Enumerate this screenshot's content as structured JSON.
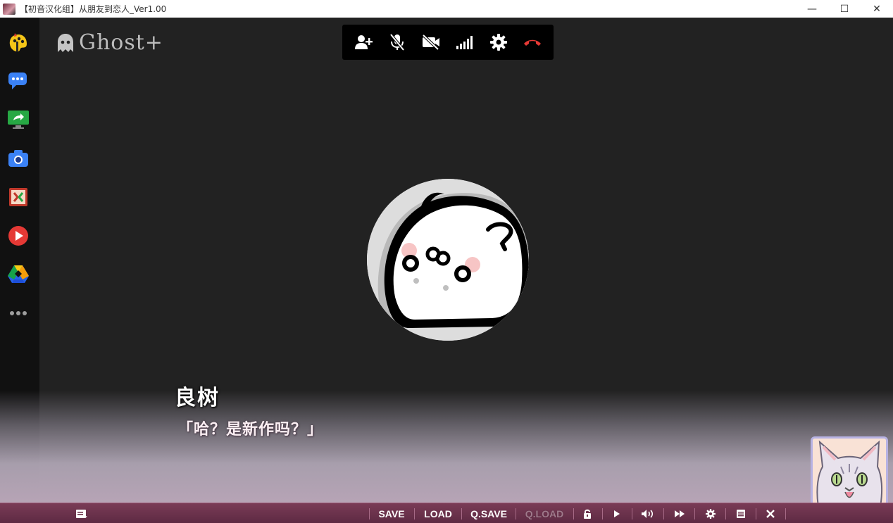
{
  "window": {
    "title": "【初音汉化组】从朋友到恋人_Ver1.00",
    "minimize_glyph": "—",
    "maximize_glyph": "☐",
    "close_glyph": "✕"
  },
  "app": {
    "logo_text": "Ghost+"
  },
  "dock": {
    "items": [
      "paint-palette-icon",
      "chat-bubbles-icon",
      "screen-share-icon",
      "camera-icon",
      "remote-desktop-icon",
      "play-icon",
      "drive-icon",
      "more-icon"
    ]
  },
  "call_toolbar": {
    "buttons": [
      "add-user-icon",
      "mic-muted-icon",
      "camera-off-icon",
      "signal-icon",
      "settings-icon",
      "hang-up-icon"
    ],
    "hang_up_color": "#e53935"
  },
  "dialogue": {
    "speaker": "良树",
    "line": "「哈？是新作吗？」"
  },
  "menu": {
    "items": [
      {
        "name": "save",
        "label": "SAVE",
        "enabled": true
      },
      {
        "name": "load",
        "label": "LOAD",
        "enabled": true
      },
      {
        "name": "qsave",
        "label": "Q.SAVE",
        "enabled": true
      },
      {
        "name": "qload",
        "label": "Q.LOAD",
        "enabled": false
      }
    ],
    "icons": [
      "backlog-icon",
      "lock-icon",
      "auto-play-icon",
      "voice-icon",
      "skip-icon",
      "config-icon",
      "menu-icon",
      "close-icon"
    ]
  },
  "colors": {
    "menu_bar": "#6a3149",
    "accent_dock_blue": "#3b82f6"
  }
}
